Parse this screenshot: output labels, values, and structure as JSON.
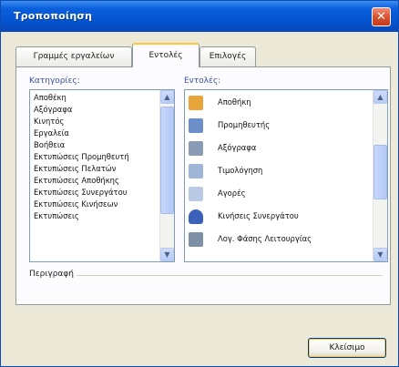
{
  "window": {
    "title": "Τροποποίηση",
    "close_glyph": "✕"
  },
  "tabs": [
    {
      "label": "Γραμμές εργαλείων"
    },
    {
      "label": "Εντολές"
    },
    {
      "label": "Επιλογές"
    }
  ],
  "categories": {
    "label": "Κατηγορίες:",
    "items": [
      "Αποθέκη",
      "Αξόγραφα",
      "Κινητός",
      "Εργαλεία",
      "Βοήθεια",
      "Εκτυπώσεις Προμηθευτή",
      "Εκτυπώσεις Πελατών",
      "Εκτυπώσεις Αποθήκης",
      "Εκτυπώσεις Συνεργάτου",
      "Εκτυπώσεις Κινήσεων",
      "Εκτυπώσεις"
    ]
  },
  "commands": {
    "label": "Εντολές:",
    "items": [
      {
        "label": "Αποθήκη",
        "icon": "warehouse-icon",
        "color": "#e8a53a"
      },
      {
        "label": "Προμηθευτής",
        "icon": "supplier-icon",
        "color": "#6d8fc9"
      },
      {
        "label": "Αξόγραφα",
        "icon": "document-icon",
        "color": "#8a9bb5"
      },
      {
        "label": "Τιμολόγηση",
        "icon": "invoice-icon",
        "color": "#9fb6d9"
      },
      {
        "label": "Αγορές",
        "icon": "purchase-icon",
        "color": "#b9c9e6"
      },
      {
        "label": "Κινήσεις Συνεργάτου",
        "icon": "partner-icon",
        "color": "#3b62b8"
      },
      {
        "label": "Λογ. Φάσης Λειτουργίας",
        "icon": "logs-icon",
        "color": "#7e8fa8"
      }
    ]
  },
  "description": {
    "label": "Περιγραφή"
  },
  "buttons": {
    "close": "Κλείσιμο"
  }
}
